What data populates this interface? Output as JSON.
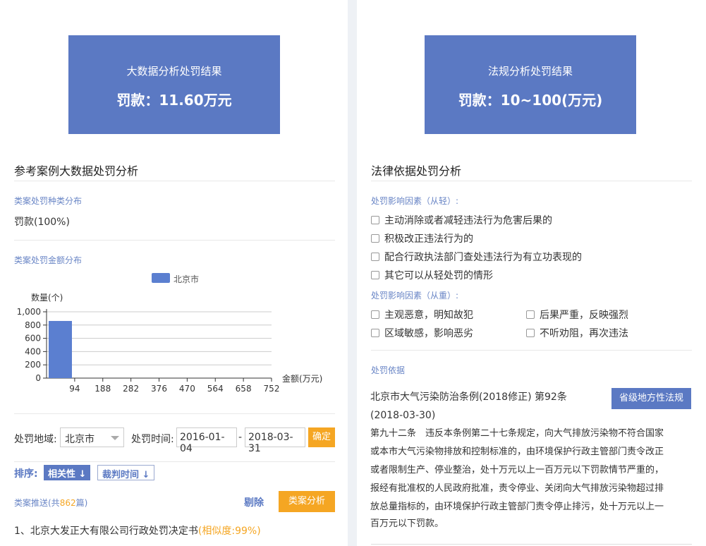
{
  "left": {
    "result": {
      "title": "大数据分析处罚结果",
      "value": "罚款：11.60万元"
    },
    "section_title": "参考案例大数据处罚分析",
    "type_dist": {
      "label": "类案处罚种类分布",
      "value": "罚款(100%)"
    },
    "amount_dist": {
      "label": "类案处罚金额分布"
    },
    "filters": {
      "region_label": "处罚地域:",
      "region_value": "北京市",
      "time_label": "处罚时间:",
      "date_from": "2016-01-04",
      "date_sep": "-",
      "date_to": "2018-03-31",
      "confirm": "确定"
    },
    "sort": {
      "label": "排序:",
      "relevance": "相关性 ↓",
      "date": "裁判时间 ↓"
    },
    "reco": {
      "prefix": "类案推送(共",
      "count": "862",
      "suffix": "篇)",
      "remove": "剔除",
      "analyze": "类案分析"
    },
    "case_item": {
      "text": "1、北京大发正大有限公司行政处罚决定书",
      "similarity": "(相似度:99%)"
    }
  },
  "right": {
    "result": {
      "title": "法规分析处罚结果",
      "value": "罚款：10~100(万元)"
    },
    "section_title": "法律依据处罚分析",
    "light": {
      "label": "处罚影响因素（从轻）:",
      "items": [
        "主动消除或者减轻违法行为危害后果的",
        "积极改正违法行为的",
        "配合行政执法部门查处违法行为有立功表现的",
        "其它可以从轻处罚的情形"
      ]
    },
    "heavy": {
      "label": "处罚影响因素（从重）:",
      "items": [
        "主观恶意，明知故犯",
        "后果严重，反映强烈",
        "区域敏感，影响恶劣",
        "不听劝阻，再次违法"
      ]
    },
    "basis": {
      "label": "处罚依据",
      "law_title": "北京市大气污染防治条例(2018修正) 第92条",
      "law_date": "(2018-03-30)",
      "badge": "省级地方性法规",
      "text_lines": [
        "第九十二条　违反本条例第二十七条规定，向大气排放污染物不符合国家",
        "或本市大气污染物排放和控制标准的，由环境保护行政主管部门责令改正",
        "或者限制生产、停业整治，处十万元以上一百万元以下罚款情节严重的，",
        "报经有批准权的人民政府批准，责令停业、关闭向大气排放污染物超过排",
        "放总量指标的，由环境保护行政主管部门责令停止排污，处十万元以上一",
        "百万元以下罚款。"
      ]
    }
  },
  "chart_data": {
    "type": "bar",
    "series": [
      {
        "name": "北京市",
        "values": [
          862,
          0,
          0,
          0,
          0,
          0,
          0,
          0
        ]
      }
    ],
    "categories": [
      "94",
      "188",
      "282",
      "376",
      "470",
      "564",
      "658",
      "752"
    ],
    "ylabel": "数量(个)",
    "xlabel": "金额(万元)",
    "ylim": [
      0,
      1000
    ],
    "yticks": [
      "0",
      "200",
      "400",
      "600",
      "800",
      "1,000"
    ],
    "color": "#5b7fd0",
    "grid": true,
    "legend": "top-center"
  }
}
